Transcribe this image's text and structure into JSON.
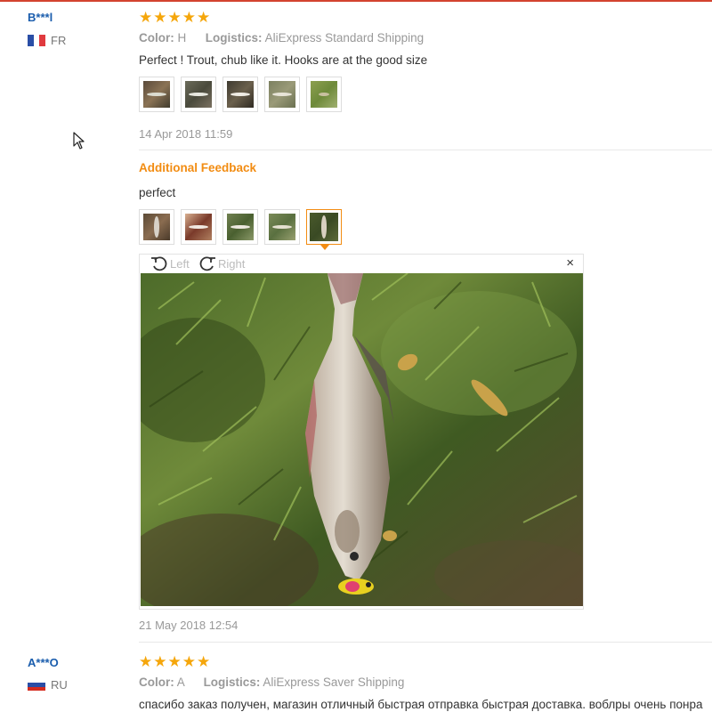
{
  "reviews": [
    {
      "user": "B***l",
      "country": "FR",
      "rating": 5,
      "color_label": "Color:",
      "color_value": "H",
      "logistics_label": "Logistics:",
      "logistics_value": "AliExpress Standard Shipping",
      "text": "Perfect ! Trout, chub like it. Hooks are at the good size",
      "date": "14 Apr 2018 11:59",
      "additional": {
        "heading": "Additional Feedback",
        "text": "perfect",
        "date": "21 May 2018 12:54"
      }
    },
    {
      "user": "A***O",
      "country": "RU",
      "rating": 5,
      "color_label": "Color:",
      "color_value": "A",
      "logistics_label": "Logistics:",
      "logistics_value": "AliExpress Saver Shipping",
      "text": "спасибо заказ получен, магазин отличный быстрая отправка быстрая доставка. воблры очень понра"
    }
  ],
  "viewer": {
    "rotate_left_label": "Left",
    "rotate_right_label": "Right",
    "close_symbol": "×"
  },
  "icons": {
    "star": "star-icon",
    "rotate_left": "rotate-left-icon",
    "rotate_right": "rotate-right-icon",
    "close": "close-icon",
    "cursor": "mouse-cursor-icon"
  },
  "colors": {
    "username": "#1a5dad",
    "star": "#f5a60b",
    "accent": "#f28c12",
    "meta": "#999999"
  }
}
